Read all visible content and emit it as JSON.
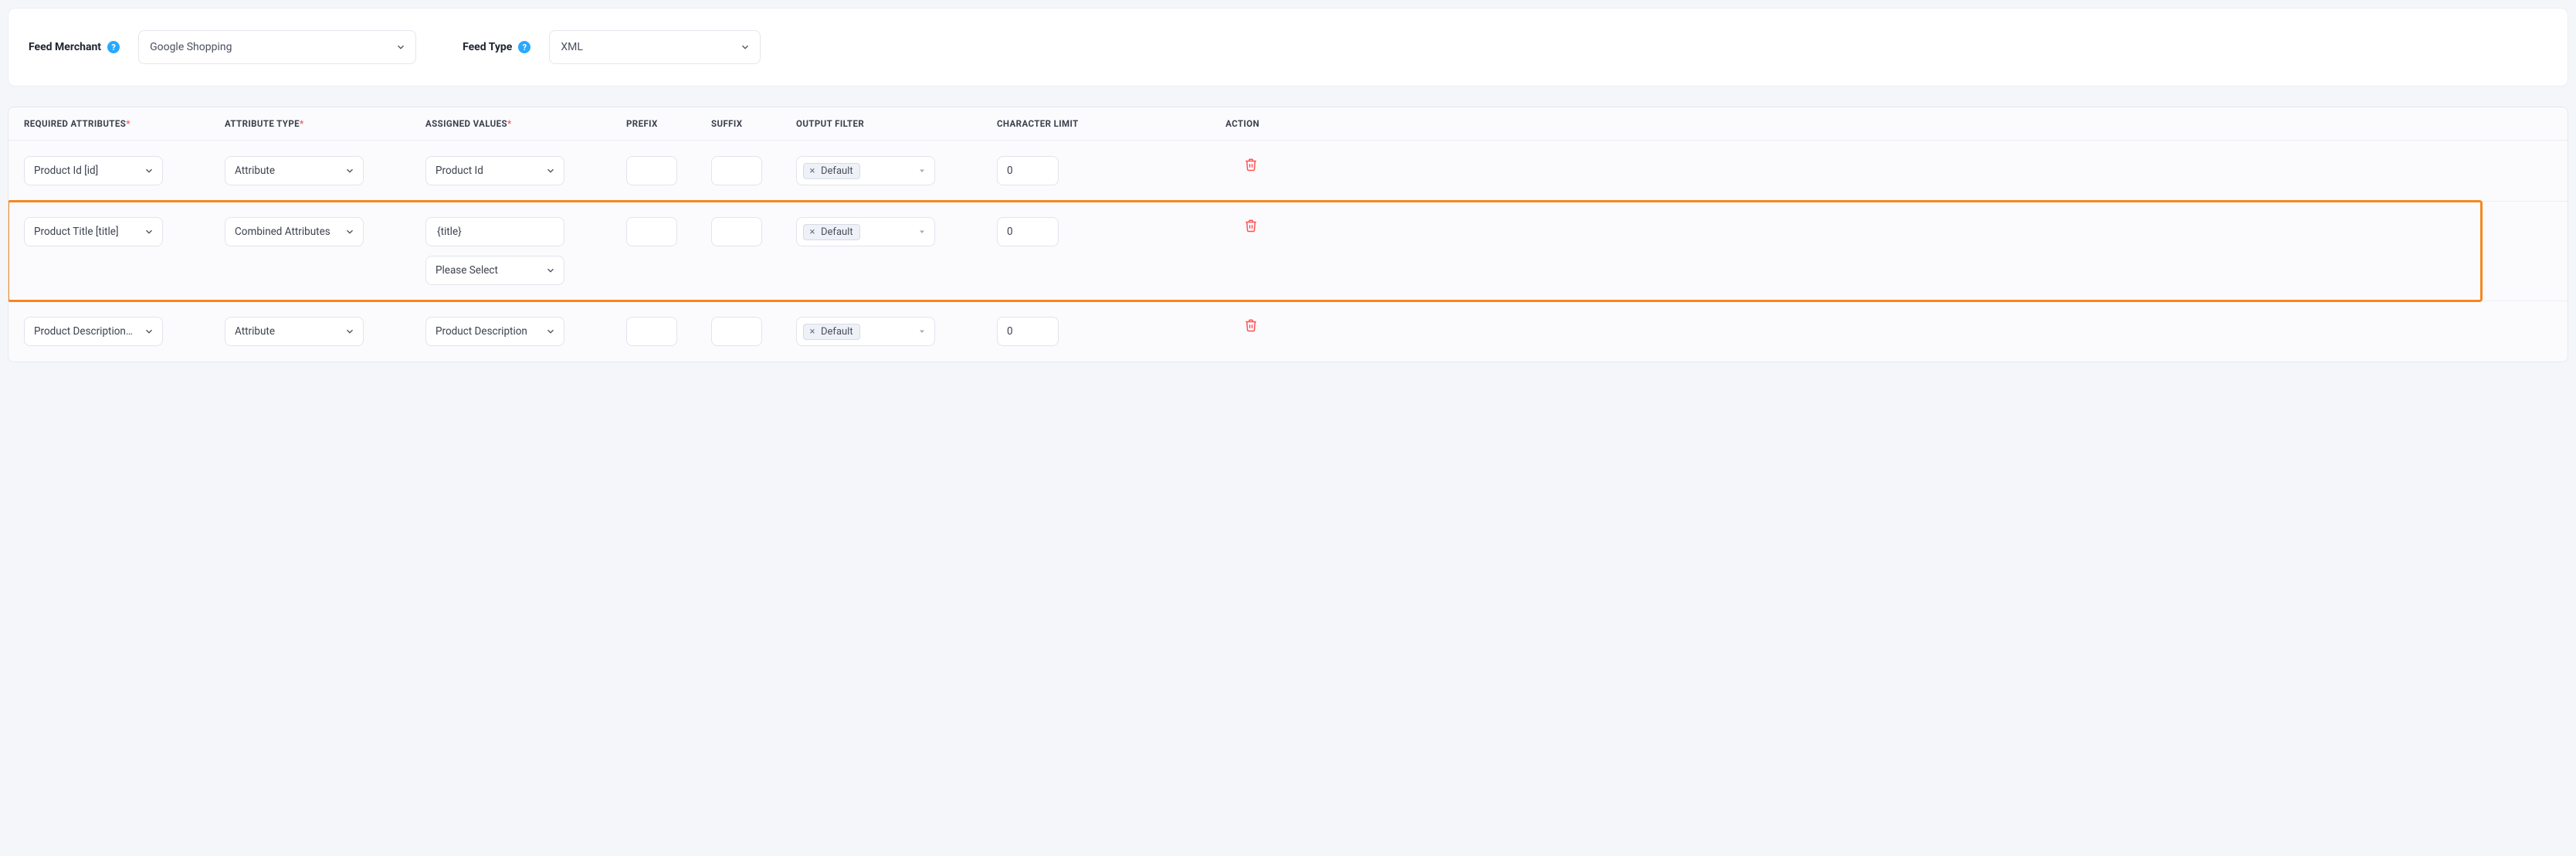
{
  "header": {
    "feed_merchant_label": "Feed Merchant",
    "feed_merchant_value": "Google Shopping",
    "feed_type_label": "Feed Type",
    "feed_type_value": "XML"
  },
  "columns": {
    "required_attributes": "REQUIRED ATTRIBUTES",
    "attribute_type": "ATTRIBUTE TYPE",
    "assigned_values": "ASSIGNED VALUES",
    "prefix": "PREFIX",
    "suffix": "SUFFIX",
    "output_filter": "OUTPUT FILTER",
    "character_limit": "CHARACTER LIMIT",
    "action": "ACTION"
  },
  "rows": [
    {
      "required_attribute": "Product Id [id]",
      "attribute_type": "Attribute",
      "assigned_values": [
        "Product Id"
      ],
      "prefix": "",
      "suffix": "",
      "output_filter_tag": "Default",
      "character_limit": "0"
    },
    {
      "required_attribute": "Product Title [title]",
      "attribute_type": "Combined Attributes",
      "assigned_values": [
        "{title}",
        "Please Select"
      ],
      "assigned_value_is_input": [
        true,
        false
      ],
      "prefix": "",
      "suffix": "",
      "output_filter_tag": "Default",
      "character_limit": "0",
      "highlighted": true
    },
    {
      "required_attribute": "Product Description [description]",
      "required_attribute_display": "Product Description [des",
      "attribute_type": "Attribute",
      "assigned_values": [
        "Product Description"
      ],
      "prefix": "",
      "suffix": "",
      "output_filter_tag": "Default",
      "character_limit": "0"
    }
  ],
  "icons": {
    "help": "?",
    "tag_remove": "×"
  }
}
